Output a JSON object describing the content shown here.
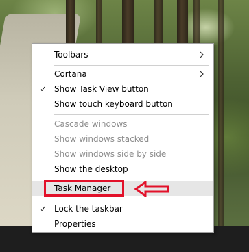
{
  "menu": {
    "items": [
      {
        "label": "Toolbars",
        "check": "",
        "submenu": true,
        "disabled": false
      },
      {
        "label": "Cortana",
        "check": "",
        "submenu": true,
        "disabled": false
      },
      {
        "label": "Show Task View button",
        "check": "✓",
        "submenu": false,
        "disabled": false
      },
      {
        "label": "Show touch keyboard button",
        "check": "",
        "submenu": false,
        "disabled": false
      },
      {
        "label": "Cascade windows",
        "check": "",
        "submenu": false,
        "disabled": true
      },
      {
        "label": "Show windows stacked",
        "check": "",
        "submenu": false,
        "disabled": true
      },
      {
        "label": "Show windows side by side",
        "check": "",
        "submenu": false,
        "disabled": true
      },
      {
        "label": "Show the desktop",
        "check": "",
        "submenu": false,
        "disabled": false
      },
      {
        "label": "Task Manager",
        "check": "",
        "submenu": false,
        "disabled": false,
        "hovered": true
      },
      {
        "label": "Lock the taskbar",
        "check": "✓",
        "submenu": false,
        "disabled": false
      },
      {
        "label": "Properties",
        "check": "",
        "submenu": false,
        "disabled": false
      }
    ]
  },
  "colors": {
    "annotation": "#e2112a",
    "menu_background": "#ffffff",
    "disabled_text": "#8d8d8d",
    "hover_background": "#e6e6e6"
  },
  "icons": {
    "submenu": "chevron-right-icon",
    "check": "check-icon",
    "annotation_arrow": "left-arrow-icon"
  }
}
